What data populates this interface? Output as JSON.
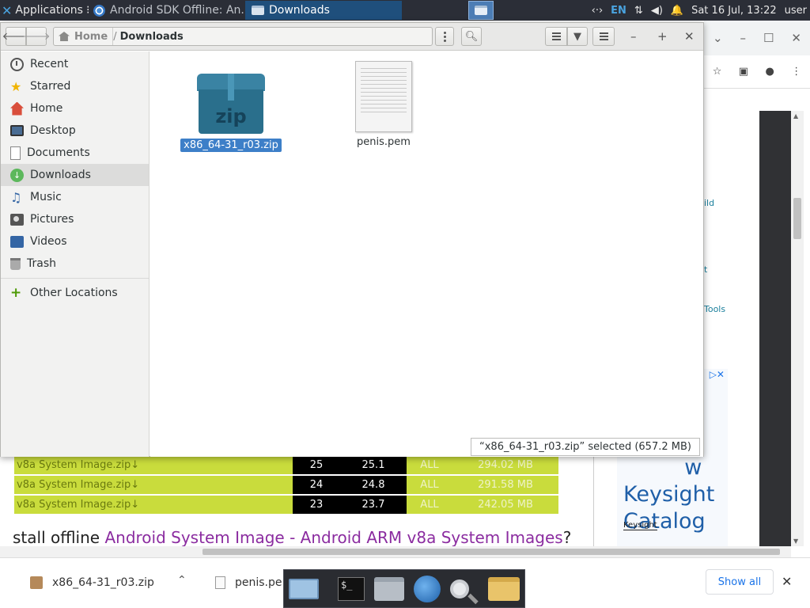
{
  "top_panel": {
    "applications_label": "Applications",
    "tasks": [
      {
        "label": "Android SDK Offline: An..."
      },
      {
        "label": "Downloads"
      }
    ],
    "keyboard_layout": "EN",
    "clock": "Sat 16 Jul, 13:22",
    "user": "user"
  },
  "file_manager": {
    "path": {
      "home": "Home",
      "current": "Downloads"
    },
    "sidebar": {
      "items": [
        {
          "label": "Recent",
          "icon": "clock-icon"
        },
        {
          "label": "Starred",
          "icon": "star-icon"
        },
        {
          "label": "Home",
          "icon": "home-icon"
        },
        {
          "label": "Desktop",
          "icon": "desktop-icon"
        },
        {
          "label": "Documents",
          "icon": "document-icon"
        },
        {
          "label": "Downloads",
          "icon": "download-icon",
          "active": true
        },
        {
          "label": "Music",
          "icon": "music-icon"
        },
        {
          "label": "Pictures",
          "icon": "camera-icon"
        },
        {
          "label": "Videos",
          "icon": "film-icon"
        },
        {
          "label": "Trash",
          "icon": "trash-icon"
        }
      ],
      "other_locations": "Other Locations"
    },
    "files": [
      {
        "name": "x86_64-31_r03.zip",
        "icon_text": "zip",
        "selected": true
      },
      {
        "name": "penis.pem",
        "selected": false
      }
    ],
    "status": "“x86_64-31_r03.zip” selected  (657.2 MB)"
  },
  "browser": {
    "sidebar_fragments": [
      "ild",
      "t",
      "Tools"
    ],
    "table_rows": [
      {
        "name": "v8a System Image.zip↓",
        "api": "25",
        "rev": "25.1",
        "arch": "ALL",
        "size": "294.02 MB"
      },
      {
        "name": "v8a System Image.zip↓",
        "api": "24",
        "rev": "24.8",
        "arch": "ALL",
        "size": "291.58 MB"
      },
      {
        "name": "v8a System Image.zip↓",
        "api": "23",
        "rev": "23.7",
        "arch": "ALL",
        "size": "242.05 MB"
      }
    ],
    "install_prefix": "stall offline ",
    "install_link": "Android System Image - Android ARM v8a System Images",
    "install_suffix": "?",
    "ad": {
      "text_lines": [
        "w",
        "Keysight",
        "Catalog"
      ],
      "brand": "Keysight"
    }
  },
  "download_shelf": {
    "items": [
      {
        "name": "x86_64-31_r03.zip"
      },
      {
        "name": "penis.pe"
      }
    ],
    "show_all_label": "Show all"
  },
  "colors": {
    "panel_bg": "#2b2e37",
    "selection": "#3d7fc8",
    "table_green": "#c9dc3c",
    "link_purple": "#8b2ca0"
  }
}
